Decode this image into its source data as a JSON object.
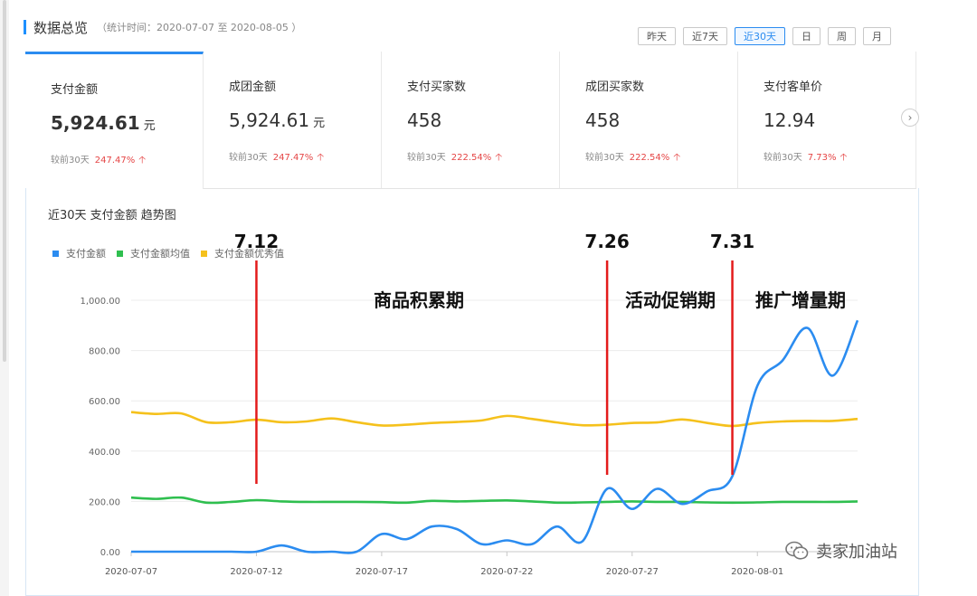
{
  "header": {
    "title": "数据总览",
    "subtitle": "（统计时间：2020-07-07 至 2020-08-05 ）"
  },
  "range_buttons": [
    "昨天",
    "近7天",
    "近30天",
    "日",
    "周",
    "月"
  ],
  "active_range": "近30天",
  "kpis": [
    {
      "label": "支付金额",
      "value": "5,924.61",
      "unit": "元",
      "compare_label": "较前30天",
      "change": "247.47%"
    },
    {
      "label": "成团金额",
      "value": "5,924.61",
      "unit": "元",
      "compare_label": "较前30天",
      "change": "247.47%"
    },
    {
      "label": "支付买家数",
      "value": "458",
      "unit": "",
      "compare_label": "较前30天",
      "change": "222.54%"
    },
    {
      "label": "成团买家数",
      "value": "458",
      "unit": "",
      "compare_label": "较前30天",
      "change": "222.54%"
    },
    {
      "label": "支付客单价",
      "value": "12.94",
      "unit": "",
      "compare_label": "较前30天",
      "change": "7.73%"
    }
  ],
  "chart_title": "近30天 支付金额 趋势图",
  "watermark": "卖家加油站",
  "colors": {
    "accent": "#2b8cf0",
    "pay": "#2b8cf0",
    "avg": "#2fbf4f",
    "best": "#f5c11c",
    "marker": "#e31b1b",
    "up": "#e54545"
  },
  "chart_data": {
    "type": "line",
    "x": [
      "2020-07-07",
      "2020-07-08",
      "2020-07-09",
      "2020-07-10",
      "2020-07-11",
      "2020-07-12",
      "2020-07-13",
      "2020-07-14",
      "2020-07-15",
      "2020-07-16",
      "2020-07-17",
      "2020-07-18",
      "2020-07-19",
      "2020-07-20",
      "2020-07-21",
      "2020-07-22",
      "2020-07-23",
      "2020-07-24",
      "2020-07-25",
      "2020-07-26",
      "2020-07-27",
      "2020-07-28",
      "2020-07-29",
      "2020-07-30",
      "2020-07-31",
      "2020-08-01",
      "2020-08-02",
      "2020-08-03",
      "2020-08-04",
      "2020-08-05"
    ],
    "xticks": [
      "2020-07-07",
      "2020-07-12",
      "2020-07-17",
      "2020-07-22",
      "2020-07-27",
      "2020-08-01"
    ],
    "yticks": [
      "0.00",
      "200.00",
      "400.00",
      "600.00",
      "800.00",
      "1,000.00"
    ],
    "ylim": [
      0,
      1000
    ],
    "series": [
      {
        "name": "支付金额",
        "values": [
          0,
          0,
          0,
          0,
          0,
          0,
          25,
          0,
          0,
          0,
          70,
          50,
          100,
          90,
          30,
          45,
          30,
          100,
          40,
          250,
          170,
          250,
          190,
          240,
          300,
          660,
          760,
          890,
          700,
          920
        ]
      },
      {
        "name": "支付金额均值",
        "values": [
          215,
          210,
          215,
          195,
          198,
          205,
          200,
          198,
          198,
          198,
          197,
          195,
          202,
          200,
          202,
          204,
          200,
          195,
          196,
          198,
          200,
          198,
          198,
          196,
          195,
          196,
          198,
          198,
          198,
          200
        ]
      },
      {
        "name": "支付金额优秀值",
        "values": [
          555,
          548,
          550,
          515,
          515,
          525,
          515,
          518,
          530,
          515,
          502,
          505,
          512,
          516,
          522,
          540,
          528,
          514,
          503,
          505,
          512,
          514,
          526,
          512,
          500,
          512,
          518,
          520,
          520,
          528
        ]
      }
    ],
    "markers": [
      {
        "date": "2020-07-12",
        "label": "7.12"
      },
      {
        "date": "2020-07-26",
        "label": "7.26"
      },
      {
        "date": "2020-07-31",
        "label": "7.31"
      }
    ],
    "phases": [
      {
        "label": "商品积累期",
        "from": "2020-07-12",
        "to": "2020-07-26"
      },
      {
        "label": "活动促销期",
        "from": "2020-07-26",
        "to": "2020-07-31"
      },
      {
        "label": "推广增量期",
        "from": "2020-07-31",
        "to": "2020-08-05"
      }
    ]
  }
}
